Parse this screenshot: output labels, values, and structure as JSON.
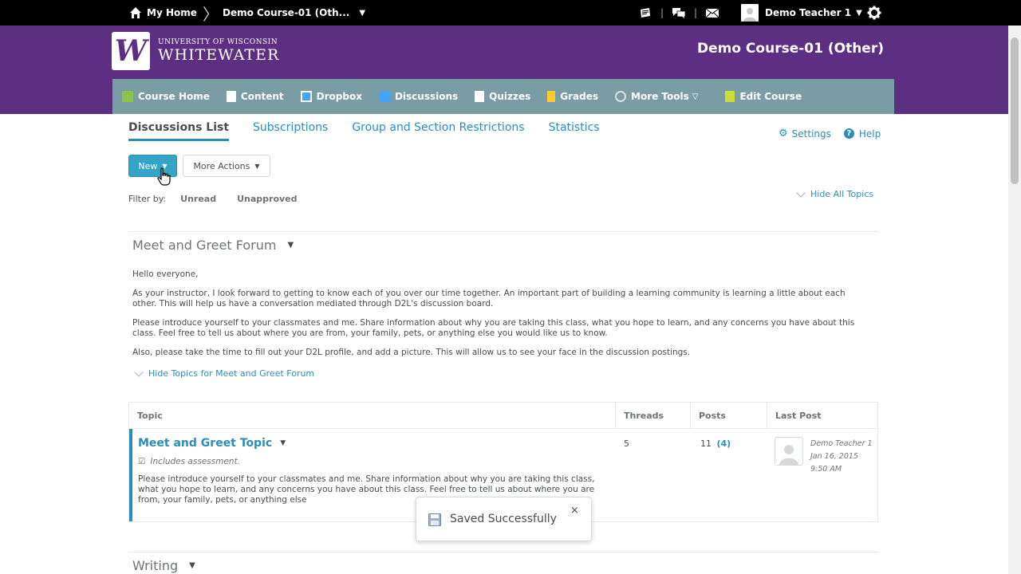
{
  "topbar": {
    "home_label": "My Home",
    "separator": "〉",
    "course_label": "Demo Course-01 (Oth...",
    "user_name": "Demo Teacher 1",
    "icon_names": [
      "email-icon",
      "chat-icon",
      "alerts-icon",
      "settings-gear-icon"
    ]
  },
  "header": {
    "logo_line1": "UNIVERSITY OF WISCONSIN",
    "logo_line2": "WHITEWATER",
    "course_title": "Demo Course-01 (Other)",
    "colors": {
      "brand": "#5c2f82",
      "nav": "#7a9ca5",
      "accent": "#2a8ebb"
    }
  },
  "nav": {
    "items": [
      {
        "label": "Course Home",
        "icon": "book-icon",
        "color": "#8bc34a"
      },
      {
        "label": "Content",
        "icon": "pages-icon",
        "color": "#ffffff"
      },
      {
        "label": "Dropbox",
        "icon": "dropbox-icon",
        "color": "#42a5f5"
      },
      {
        "label": "Discussions",
        "icon": "discussions-icon",
        "color": "#42a5f5"
      },
      {
        "label": "Quizzes",
        "icon": "quiz-icon",
        "color": "#ffffff"
      },
      {
        "label": "Grades",
        "icon": "grades-icon",
        "color": "#ffca28"
      },
      {
        "label": "More Tools",
        "icon": "tools-icon",
        "color": "#e0e0e0"
      },
      {
        "label": "Edit Course",
        "icon": "edit-course-icon",
        "color": "#cddc39"
      }
    ]
  },
  "tabs": [
    {
      "label": "Discussions List",
      "active": true
    },
    {
      "label": "Subscriptions",
      "active": false
    },
    {
      "label": "Group and Section Restrictions",
      "active": false
    },
    {
      "label": "Statistics",
      "active": false
    }
  ],
  "actions": {
    "settings_label": "Settings",
    "help_label": "Help",
    "new_label": "New",
    "more_actions_label": "More Actions",
    "filter_label": "Filter by:",
    "filter_unread": "Unread",
    "filter_unapproved": "Unapproved",
    "hide_all_topics": "Hide All Topics"
  },
  "forum": {
    "title": "Meet and Greet Forum",
    "paragraphs": [
      "Hello everyone,",
      "As your instructor, I look forward to getting to know each of you over our time together.  An important part of building a learning community is learning a little about each other.  This will help us have a conversation mediated through D2L's discussion board.",
      "Please introduce yourself to your classmates and me.  Share information about why you are taking this class, what you hope to learn, and any concerns you have about this class.  Feel free to tell us about where you are from, your family, pets, or anything else you would like us to know.",
      "Also, please take the time to fill out your D2L profile, and add a picture.  This will allow us to see your face in the discussion postings."
    ],
    "hide_topics_label": "Hide Topics for Meet and Greet Forum"
  },
  "table": {
    "headers": {
      "topic": "Topic",
      "threads": "Threads",
      "posts": "Posts",
      "last_post": "Last Post"
    },
    "row": {
      "title": "Meet and Greet Topic",
      "assessment": "Includes assessment.",
      "description": "Please introduce yourself to your classmates and me.  Share information about why you are taking this class, what you hope to learn, and any concerns you have about this class.  Feel free to tell us about where you are from, your family, pets, or anything else",
      "threads": "5",
      "posts": "11",
      "posts_unread": "(4)",
      "last_post_author": "Demo Teacher 1",
      "last_post_date": "Jan 16, 2015",
      "last_post_time": "9:50 AM"
    }
  },
  "toast": {
    "message": "Saved Successfully",
    "close": "×"
  },
  "next_forum": {
    "title": "Writing"
  }
}
